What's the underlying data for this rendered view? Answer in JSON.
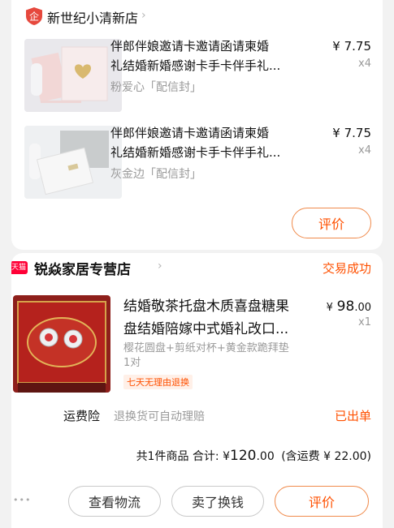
{
  "store1": {
    "icon_text": "企",
    "name": "新世纪小清新店",
    "items": [
      {
        "title_line1": "伴郎伴娘邀请卡邀请函请柬婚",
        "title_line2": "礼结婚新婚感谢卡手卡伴手礼...",
        "sku": "粉爱心「配信封」",
        "price": "¥ 7.75",
        "qty": "x4"
      },
      {
        "title_line1": "伴郎伴娘邀请卡邀请函请柬婚",
        "title_line2": "礼结婚新婚感谢卡手卡伴手礼...",
        "sku": "灰金边「配信封」",
        "price": "¥ 7.75",
        "qty": "x4"
      }
    ],
    "review_button": "评价"
  },
  "store2": {
    "badge_text": "天猫",
    "name": "锐焱家居专营店",
    "status": "交易成功",
    "item": {
      "title_line1": "结婚敬茶托盘木质喜盘糖果",
      "title_line2": "盘结婚陪嫁中式婚礼改口...",
      "sku_line1": "樱花圆盘+剪纸对杯+黄金款跪拜垫",
      "sku_line2": "1对",
      "tag": "七天无理由退换",
      "price_symbol": "¥",
      "price_int": "98",
      "price_dec": ".00",
      "qty": "x1"
    },
    "insurance": {
      "label": "运费险",
      "desc": "退换货可自动理赔",
      "status": "已出单"
    },
    "summary": {
      "count_text": "共1件商品",
      "total_label": "合计: ¥",
      "total_int": "120",
      "total_dec": ".00",
      "shipping": "(含运费 ¥ 22.00)"
    },
    "actions": {
      "more": "•••",
      "logistics": "查看物流",
      "resell": "卖了换钱",
      "review": "评价"
    }
  },
  "colors": {
    "accent": "#ff5000",
    "store_icon": "#e6483d",
    "tmall": "#ff0036"
  }
}
